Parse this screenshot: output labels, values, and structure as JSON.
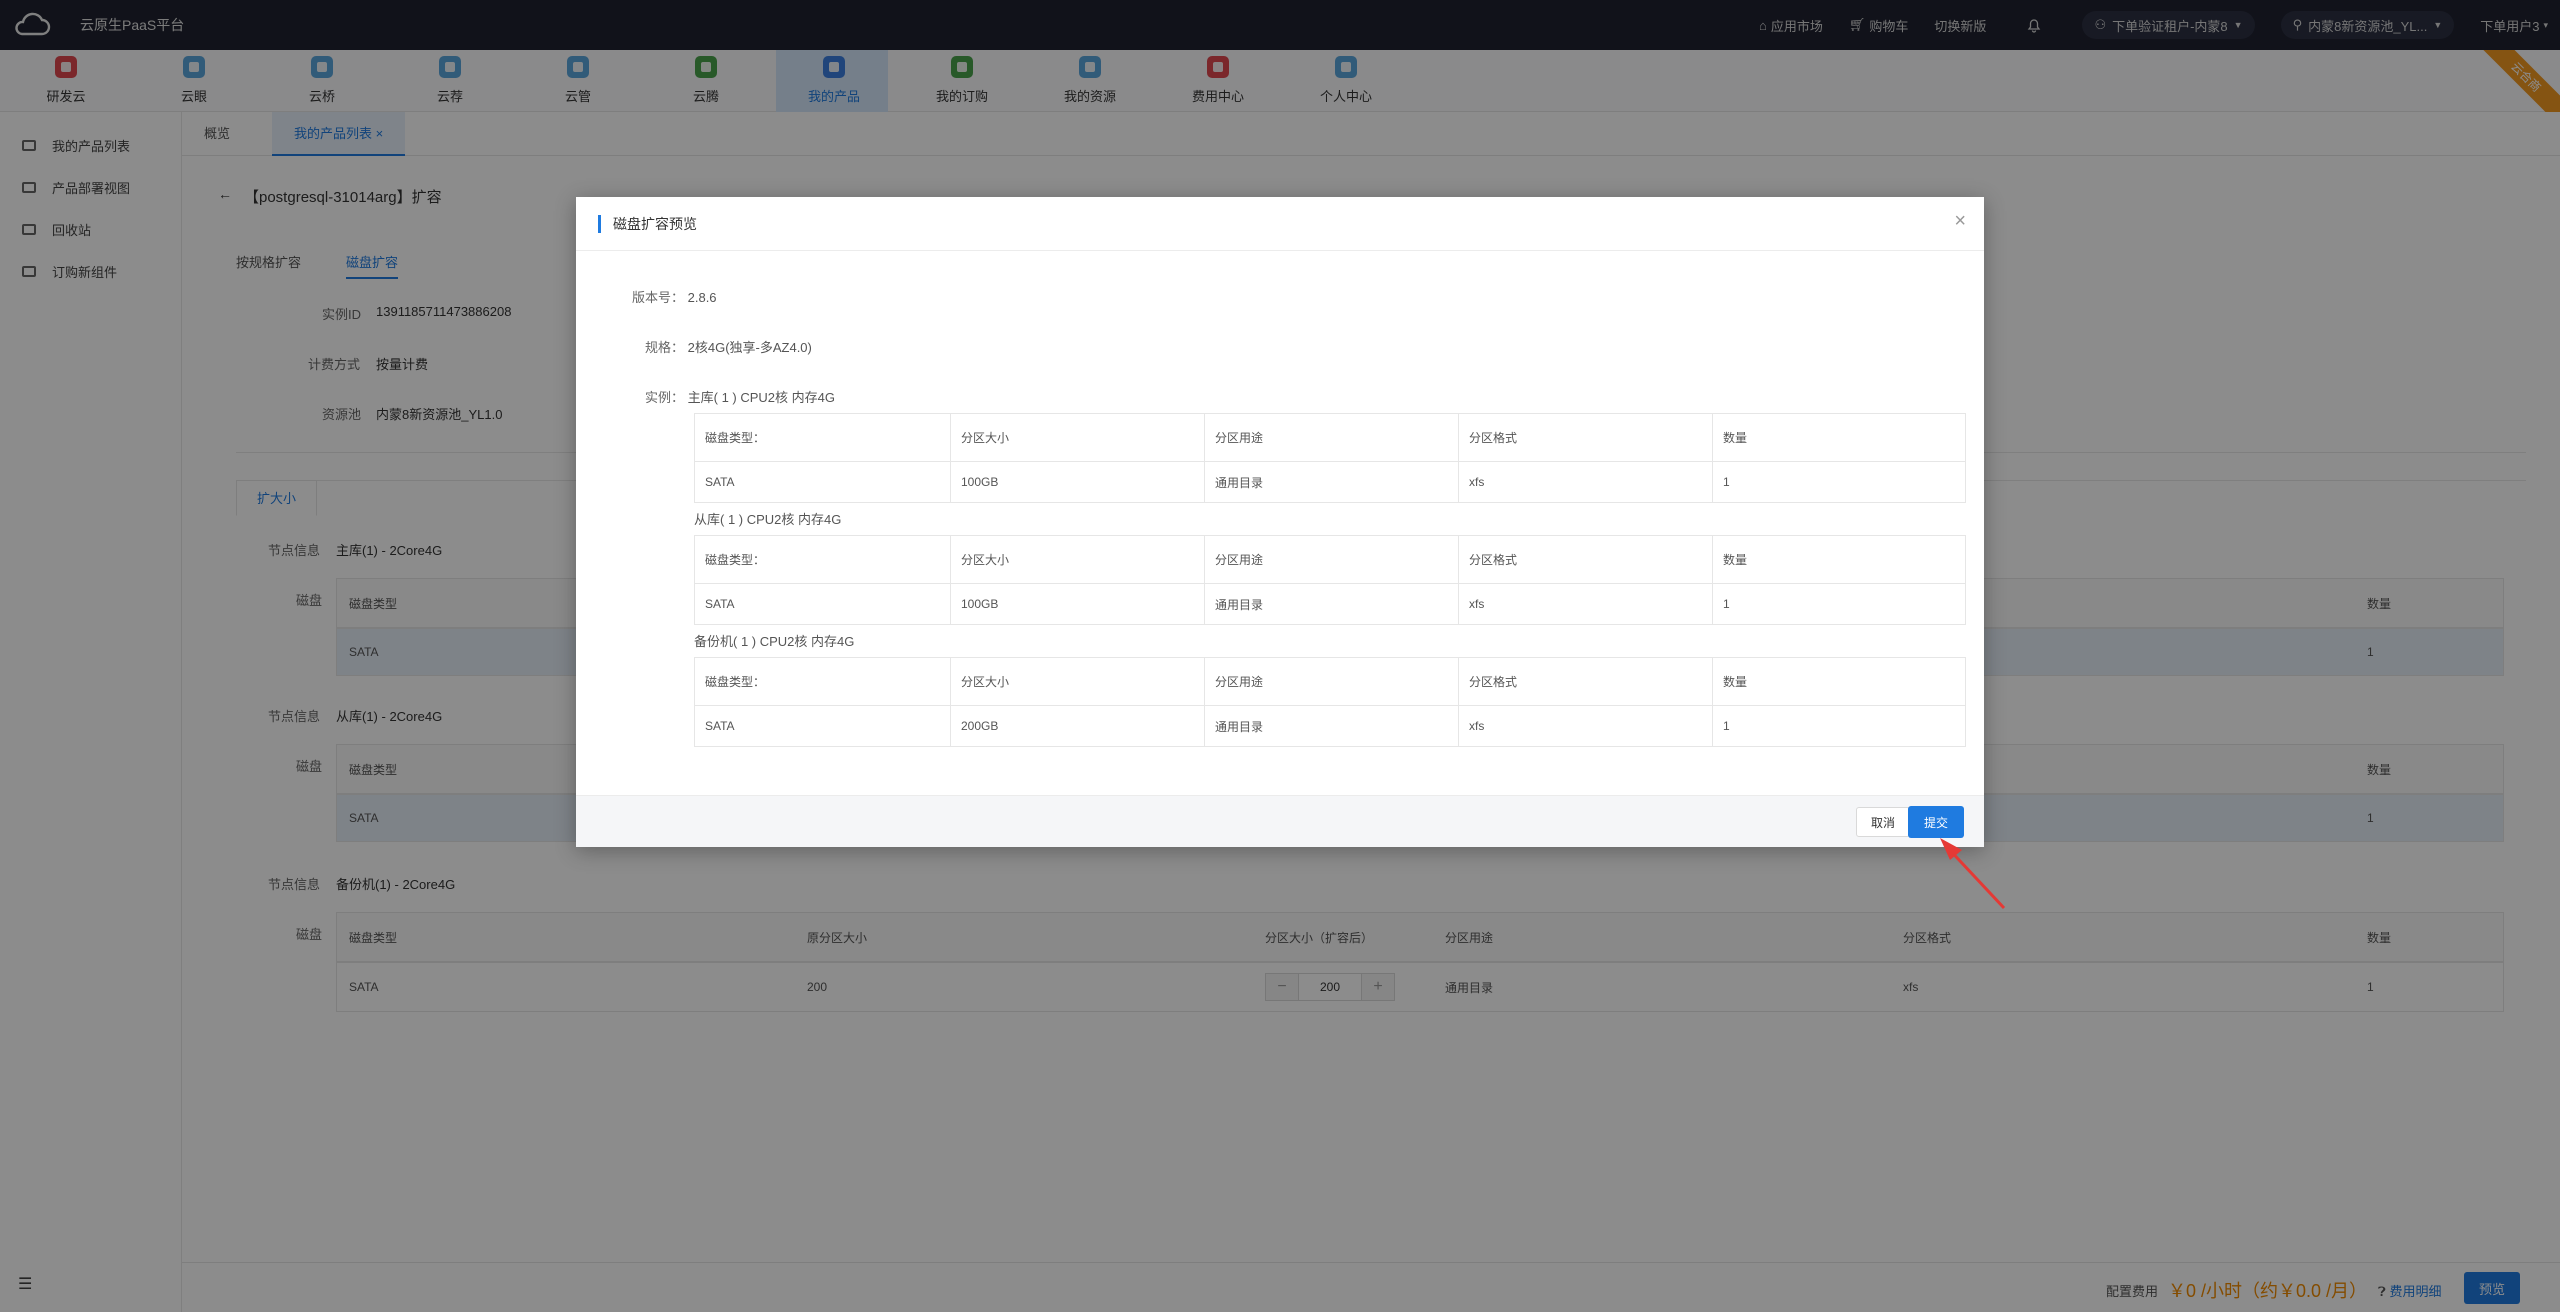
{
  "topbar": {
    "brand": "云原生PaaS平台",
    "app_market": "应用市场",
    "cart": "购物车",
    "switch_version": "切换新版",
    "tenant": "下单验证租户-内蒙8",
    "pool": "内蒙8新资源池_YL...",
    "user": "下单用户3"
  },
  "nav": {
    "items": [
      {
        "label": "研发云",
        "color": "#e0484f"
      },
      {
        "label": "云眼",
        "color": "#5aa6dc"
      },
      {
        "label": "云桥",
        "color": "#5aa6dc"
      },
      {
        "label": "云荐",
        "color": "#5aa6dc"
      },
      {
        "label": "云管",
        "color": "#5aa6dc"
      },
      {
        "label": "云腾",
        "color": "#49a34b"
      },
      {
        "label": "我的产品",
        "color": "#3b7fe0"
      },
      {
        "label": "我的订购",
        "color": "#49a34b"
      },
      {
        "label": "我的资源",
        "color": "#5aa6dc"
      },
      {
        "label": "费用中心",
        "color": "#e0484f"
      },
      {
        "label": "个人中心",
        "color": "#5aa6dc"
      }
    ],
    "ribbon": "云合商"
  },
  "sidebar": {
    "items": [
      {
        "label": "我的产品列表"
      },
      {
        "label": "产品部署视图"
      },
      {
        "label": "回收站"
      },
      {
        "label": "订购新组件"
      }
    ]
  },
  "tabs": {
    "overview": "概览",
    "product_list": "我的产品列表",
    "close": "×"
  },
  "page": {
    "back": "←",
    "title": "【postgresql-31014arg】扩容",
    "subtab_spec": "按规格扩容",
    "subtab_disk": "磁盘扩容",
    "instance_id_label": "实例ID",
    "instance_id": "1391185711473886208",
    "billing_label": "计费方式",
    "billing": "按量计费",
    "pool_label": "资源池",
    "pool": "内蒙8新资源池_YL1.0",
    "expand_tab": "扩大小",
    "node_label": "节点信息",
    "disk_label": "磁盘",
    "nodes": [
      {
        "name": "主库(1) -  2Core4G",
        "header": [
          "磁盘类型",
          "数量"
        ],
        "row": [
          "SATA",
          "1"
        ]
      },
      {
        "name": "从库(1) -  2Core4G",
        "header": [
          "磁盘类型",
          "数量"
        ],
        "row": [
          "SATA",
          "1"
        ]
      },
      {
        "name": "备份机(1) -  2Core4G",
        "header": [
          "磁盘类型",
          "原分区大小",
          "分区大小（扩容后）",
          "分区用途",
          "分区格式",
          "数量"
        ],
        "row": [
          "SATA",
          "200",
          "",
          "通用目录",
          "xfs",
          "1"
        ]
      }
    ],
    "stepper_value": "200",
    "stepper_minus": "−",
    "stepper_plus": "+"
  },
  "footer": {
    "cost_label": "配置费用",
    "cost_value": "￥0 /小时（约￥0.0 /月）",
    "detail": "费用明细",
    "preview": "预览"
  },
  "modal": {
    "title": "磁盘扩容预览",
    "close": "×",
    "version_label": "版本号：",
    "version": "2.8.6",
    "spec_label": "规格：",
    "spec": "2核4G(独享-多AZ4.0)",
    "instance_label": "实例：",
    "headers": [
      "磁盘类型：",
      "分区大小",
      "分区用途",
      "分区格式",
      "数量"
    ],
    "groups": [
      {
        "title": "主库( 1 )   CPU2核  内存4G",
        "row": [
          "SATA",
          "100GB",
          "通用目录",
          "xfs",
          "1"
        ]
      },
      {
        "title": "从库( 1 )   CPU2核  内存4G",
        "row": [
          "SATA",
          "100GB",
          "通用目录",
          "xfs",
          "1"
        ]
      },
      {
        "title": "备份机( 1 )   CPU2核  内存4G",
        "row": [
          "SATA",
          "200GB",
          "通用目录",
          "xfs",
          "1"
        ]
      }
    ],
    "cancel": "取消",
    "submit": "提交"
  },
  "colors": {
    "accent": "#1f7be0",
    "topbar": "#1f2230",
    "arrow": "#e53935"
  }
}
